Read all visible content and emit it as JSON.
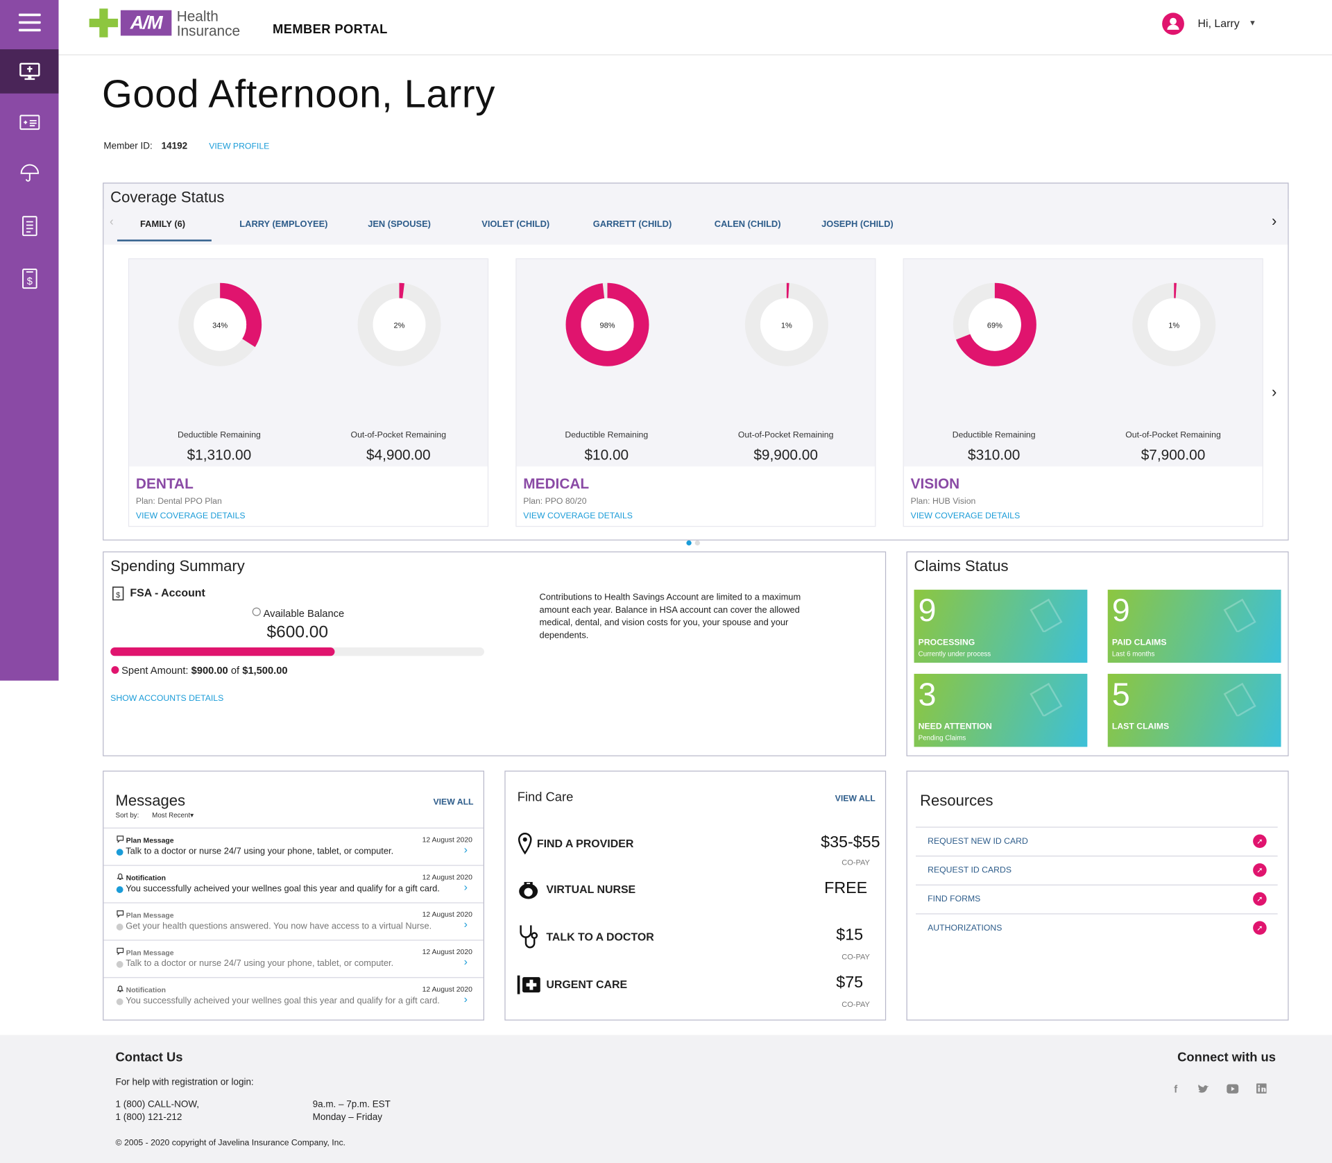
{
  "header": {
    "brand_am": "A/M",
    "brand_line1": "Health",
    "brand_line2": "Insurance",
    "portal": "MEMBER PORTAL",
    "greeting_user": "Hi, Larry"
  },
  "greeting": "Good Afternoon, Larry",
  "member": {
    "label": "Member ID:",
    "id": "14192",
    "view_profile": "VIEW PROFILE"
  },
  "coverage": {
    "title": "Coverage Status",
    "tabs": [
      "FAMILY (6)",
      "LARRY (EMPLOYEE)",
      "JEN (SPOUSE)",
      "VIOLET (CHILD)",
      "GARRETT (CHILD)",
      "CALEN (CHILD)",
      "JOSEPH (CHILD)"
    ],
    "cards": [
      {
        "name": "DENTAL",
        "plan": "Plan: Dental PPO Plan",
        "link": "VIEW COVERAGE DETAILS",
        "ded_pct_label": "34%",
        "ded_pct": 0.34,
        "oop_pct_label": "2%",
        "oop_pct": 0.02,
        "ded_label": "Deductible Remaining",
        "ded_amt": "$1,310.00",
        "oop_label": "Out-of-Pocket Remaining",
        "oop_amt": "$4,900.00"
      },
      {
        "name": "MEDICAL",
        "plan": "Plan: PPO 80/20",
        "link": "VIEW COVERAGE DETAILS",
        "ded_pct_label": "98%",
        "ded_pct": 0.98,
        "oop_pct_label": "1%",
        "oop_pct": 0.01,
        "ded_label": "Deductible Remaining",
        "ded_amt": "$10.00",
        "oop_label": "Out-of-Pocket Remaining",
        "oop_amt": "$9,900.00"
      },
      {
        "name": "VISION",
        "plan": "Plan: HUB Vision",
        "link": "VIEW COVERAGE DETAILS",
        "ded_pct_label": "69%",
        "ded_pct": 0.69,
        "oop_pct_label": "1%",
        "oop_pct": 0.01,
        "ded_label": "Deductible Remaining",
        "ded_amt": "$310.00",
        "oop_label": "Out-of-Pocket Remaining",
        "oop_amt": "$7,900.00"
      }
    ]
  },
  "spending": {
    "title": "Spending Summary",
    "account": "FSA - Account",
    "available_label": "Available Balance",
    "available": "$600.00",
    "spent_fraction": 0.6,
    "spent_label": "Spent Amount:",
    "spent": "$900.00",
    "of": "of",
    "total": "$1,500.00",
    "show_details": "SHOW ACCOUNTS DETAILS",
    "info": "Contributions to Health Savings Account are limited to a maximum amount each year. Balance in HSA account can cover the allowed medical, dental, and vision costs for you, your spouse and your dependents."
  },
  "claims": {
    "title": "Claims Status",
    "tiles": [
      {
        "n": "9",
        "title": "PROCESSING",
        "sub": "Currently under process"
      },
      {
        "n": "9",
        "title": "PAID CLAIMS",
        "sub": "Last 6 months"
      },
      {
        "n": "3",
        "title": "NEED ATTENTION",
        "sub": "Pending Claims"
      },
      {
        "n": "5",
        "title": "LAST CLAIMS",
        "sub": ""
      }
    ]
  },
  "messages": {
    "title": "Messages",
    "view_all": "VIEW ALL",
    "sort_label": "Sort by:",
    "sort_value": "Most Recent",
    "items": [
      {
        "type": "Plan Message",
        "date": "12 August 2020",
        "text": "Talk to a doctor or nurse 24/7 using your phone, tablet, or computer."
      },
      {
        "type": "Notification",
        "date": "12 August 2020",
        "text": "You successfully acheived your wellnes goal this year and qualify for a gift card."
      },
      {
        "type": "Plan Message",
        "date": "12 August 2020",
        "text": "Get your health questions answered. You now have access to a virtual Nurse."
      },
      {
        "type": "Plan Message",
        "date": "12 August 2020",
        "text": "Talk to a doctor or nurse 24/7 using your phone, tablet, or computer."
      },
      {
        "type": "Notification",
        "date": "12 August 2020",
        "text": "You successfully acheived your wellnes goal this year and qualify for a gift card."
      }
    ]
  },
  "findcare": {
    "title": "Find Care",
    "view_all": "VIEW ALL",
    "items": [
      {
        "label": "FIND A PROVIDER",
        "price": "$35-$55",
        "sub": "CO-PAY"
      },
      {
        "label": "VIRTUAL NURSE",
        "price": "FREE",
        "sub": ""
      },
      {
        "label": "TALK TO A DOCTOR",
        "price": "$15",
        "sub": "CO-PAY"
      },
      {
        "label": "URGENT CARE",
        "price": "$75",
        "sub": "CO-PAY"
      }
    ]
  },
  "resources": {
    "title": "Resources",
    "items": [
      "REQUEST NEW ID CARD",
      "REQUEST ID CARDS",
      "FIND FORMS",
      "AUTHORIZATIONS"
    ]
  },
  "footer": {
    "contact_title": "Contact Us",
    "help": "For help with registration or login:",
    "phone1": "1 (800) CALL-NOW,",
    "phone2": "1 (800) 121-212",
    "hours": "9a.m. – 7p.m. EST",
    "days": "Monday – Friday",
    "copyright": "© 2005 - 2020 copyright of Javelina Insurance Company, Inc.",
    "connect": "Connect with us"
  },
  "colors": {
    "brand": "#8a4aa5",
    "accent": "#e0146e",
    "link": "#1b9cd8"
  }
}
